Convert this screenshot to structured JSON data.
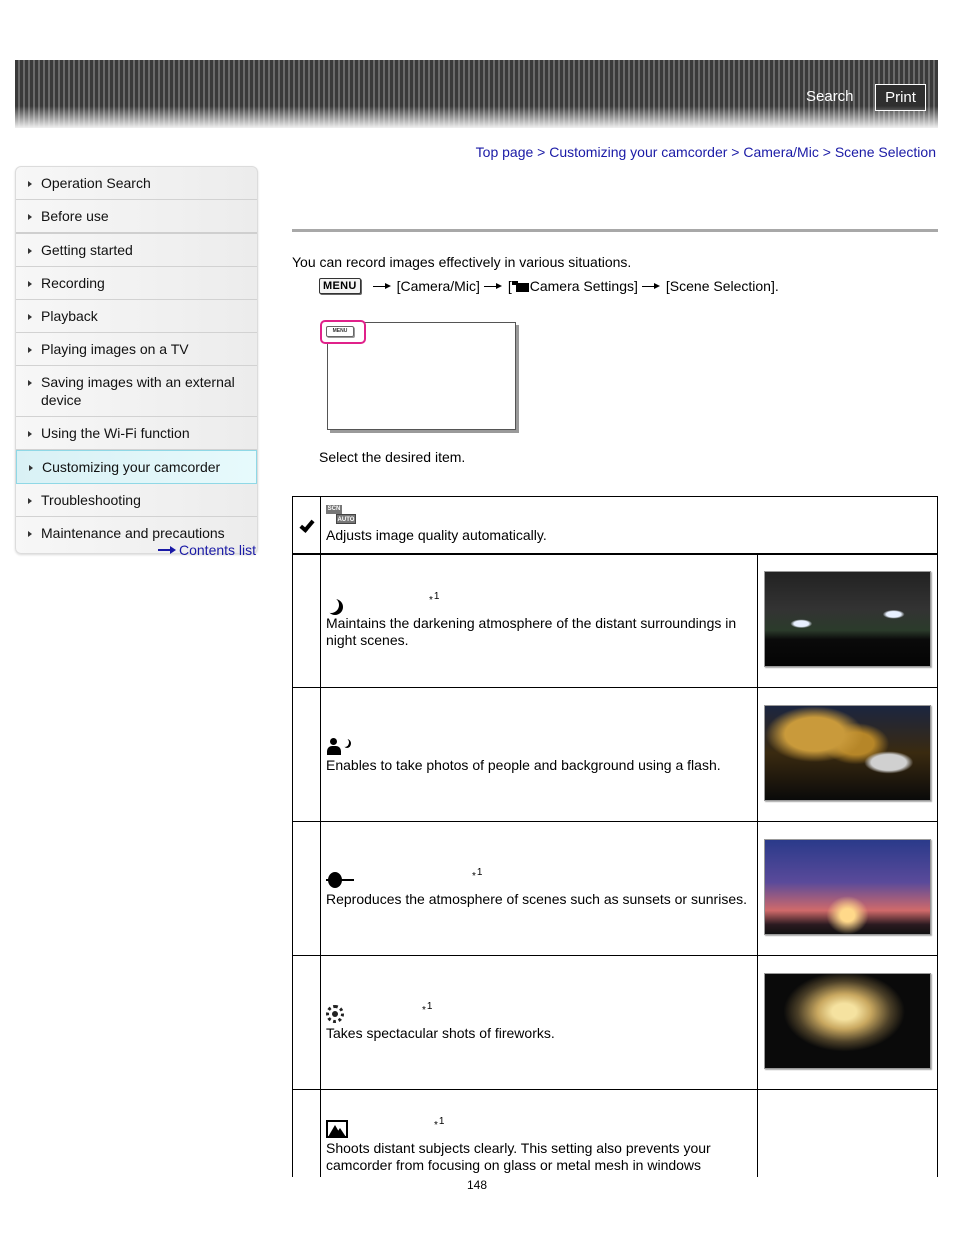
{
  "header": {
    "search_label": "Search",
    "print_label": "Print"
  },
  "breadcrumb": {
    "items": [
      "Top page",
      "Customizing your camcorder",
      "Camera/Mic",
      "Scene Selection"
    ],
    "separator": ">"
  },
  "sidebar": {
    "items": [
      {
        "label": "Operation Search"
      },
      {
        "label": "Before use"
      },
      {
        "label": "Getting started"
      },
      {
        "label": "Recording"
      },
      {
        "label": "Playback"
      },
      {
        "label": "Playing images on a TV"
      },
      {
        "label": "Saving images with an external device"
      },
      {
        "label": "Using the Wi-Fi function"
      },
      {
        "label": "Customizing your camcorder",
        "active": true
      },
      {
        "label": "Troubleshooting"
      },
      {
        "label": "Maintenance and precautions"
      }
    ],
    "contents_link": "Contents list",
    "active_color": "#d9f1f5"
  },
  "main": {
    "intro": "You can record images effectively in various situations.",
    "step": {
      "menu_key": "MENU",
      "part1": "[Camera/Mic]",
      "part2_prefix": "[",
      "part2": "Camera Settings]",
      "part3": "[Scene Selection]."
    },
    "figure": {
      "menu_key": "MENU",
      "highlight_color": "#e0218a"
    },
    "select_text": "Select the desired item.",
    "scenes": [
      {
        "icon": "scn-auto-icon",
        "icon_text_top": "SCN",
        "icon_text_bottom": "AUTO",
        "selected": true,
        "footnote": "",
        "description": "Adjusts image quality automatically.",
        "photo": null
      },
      {
        "icon": "moon-icon",
        "selected": false,
        "footnote": "1",
        "description": "Maintains the darkening atmosphere of the distant surroundings in night scenes.",
        "photo": "night-bridge-photo"
      },
      {
        "icon": "night-portrait-icon",
        "selected": false,
        "footnote": "",
        "description": "Enables to take photos of people and background using a flash.",
        "photo": "night-portrait-photo"
      },
      {
        "icon": "sunset-icon",
        "selected": false,
        "footnote": "1",
        "description": "Reproduces the atmosphere of scenes such as sunsets or sunrises.",
        "photo": "sunset-palms-photo"
      },
      {
        "icon": "fireworks-icon",
        "selected": false,
        "footnote": "1",
        "description": "Takes spectacular shots of fireworks.",
        "photo": "fireworks-photo"
      },
      {
        "icon": "landscape-icon",
        "selected": false,
        "footnote": "1",
        "description": "Shoots distant subjects clearly. This setting also prevents your camcorder from focusing on glass or metal mesh in windows",
        "photo": null
      }
    ],
    "footnote_marker": "*"
  },
  "page_number": "148"
}
